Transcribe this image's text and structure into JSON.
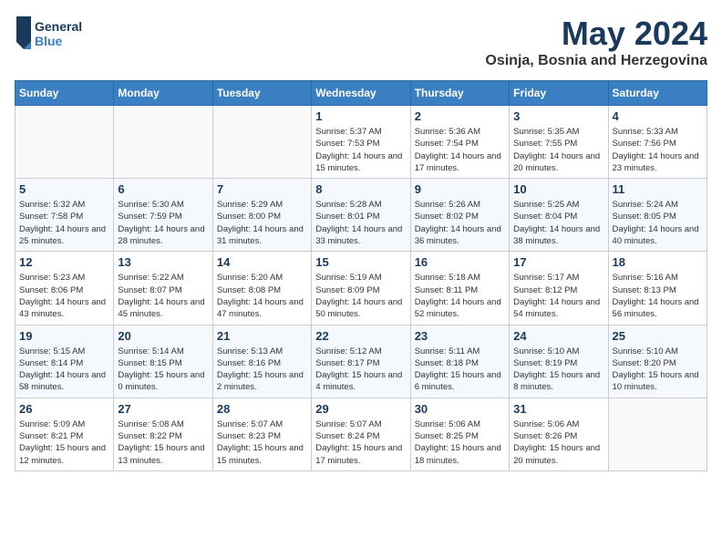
{
  "logo": {
    "line1": "General",
    "line2": "Blue"
  },
  "title": "May 2024",
  "location": "Osinja, Bosnia and Herzegovina",
  "days_of_week": [
    "Sunday",
    "Monday",
    "Tuesday",
    "Wednesday",
    "Thursday",
    "Friday",
    "Saturday"
  ],
  "weeks": [
    [
      {
        "day": "",
        "info": ""
      },
      {
        "day": "",
        "info": ""
      },
      {
        "day": "",
        "info": ""
      },
      {
        "day": "1",
        "info": "Sunrise: 5:37 AM\nSunset: 7:53 PM\nDaylight: 14 hours and 15 minutes."
      },
      {
        "day": "2",
        "info": "Sunrise: 5:36 AM\nSunset: 7:54 PM\nDaylight: 14 hours and 17 minutes."
      },
      {
        "day": "3",
        "info": "Sunrise: 5:35 AM\nSunset: 7:55 PM\nDaylight: 14 hours and 20 minutes."
      },
      {
        "day": "4",
        "info": "Sunrise: 5:33 AM\nSunset: 7:56 PM\nDaylight: 14 hours and 23 minutes."
      }
    ],
    [
      {
        "day": "5",
        "info": "Sunrise: 5:32 AM\nSunset: 7:58 PM\nDaylight: 14 hours and 25 minutes."
      },
      {
        "day": "6",
        "info": "Sunrise: 5:30 AM\nSunset: 7:59 PM\nDaylight: 14 hours and 28 minutes."
      },
      {
        "day": "7",
        "info": "Sunrise: 5:29 AM\nSunset: 8:00 PM\nDaylight: 14 hours and 31 minutes."
      },
      {
        "day": "8",
        "info": "Sunrise: 5:28 AM\nSunset: 8:01 PM\nDaylight: 14 hours and 33 minutes."
      },
      {
        "day": "9",
        "info": "Sunrise: 5:26 AM\nSunset: 8:02 PM\nDaylight: 14 hours and 36 minutes."
      },
      {
        "day": "10",
        "info": "Sunrise: 5:25 AM\nSunset: 8:04 PM\nDaylight: 14 hours and 38 minutes."
      },
      {
        "day": "11",
        "info": "Sunrise: 5:24 AM\nSunset: 8:05 PM\nDaylight: 14 hours and 40 minutes."
      }
    ],
    [
      {
        "day": "12",
        "info": "Sunrise: 5:23 AM\nSunset: 8:06 PM\nDaylight: 14 hours and 43 minutes."
      },
      {
        "day": "13",
        "info": "Sunrise: 5:22 AM\nSunset: 8:07 PM\nDaylight: 14 hours and 45 minutes."
      },
      {
        "day": "14",
        "info": "Sunrise: 5:20 AM\nSunset: 8:08 PM\nDaylight: 14 hours and 47 minutes."
      },
      {
        "day": "15",
        "info": "Sunrise: 5:19 AM\nSunset: 8:09 PM\nDaylight: 14 hours and 50 minutes."
      },
      {
        "day": "16",
        "info": "Sunrise: 5:18 AM\nSunset: 8:11 PM\nDaylight: 14 hours and 52 minutes."
      },
      {
        "day": "17",
        "info": "Sunrise: 5:17 AM\nSunset: 8:12 PM\nDaylight: 14 hours and 54 minutes."
      },
      {
        "day": "18",
        "info": "Sunrise: 5:16 AM\nSunset: 8:13 PM\nDaylight: 14 hours and 56 minutes."
      }
    ],
    [
      {
        "day": "19",
        "info": "Sunrise: 5:15 AM\nSunset: 8:14 PM\nDaylight: 14 hours and 58 minutes."
      },
      {
        "day": "20",
        "info": "Sunrise: 5:14 AM\nSunset: 8:15 PM\nDaylight: 15 hours and 0 minutes."
      },
      {
        "day": "21",
        "info": "Sunrise: 5:13 AM\nSunset: 8:16 PM\nDaylight: 15 hours and 2 minutes."
      },
      {
        "day": "22",
        "info": "Sunrise: 5:12 AM\nSunset: 8:17 PM\nDaylight: 15 hours and 4 minutes."
      },
      {
        "day": "23",
        "info": "Sunrise: 5:11 AM\nSunset: 8:18 PM\nDaylight: 15 hours and 6 minutes."
      },
      {
        "day": "24",
        "info": "Sunrise: 5:10 AM\nSunset: 8:19 PM\nDaylight: 15 hours and 8 minutes."
      },
      {
        "day": "25",
        "info": "Sunrise: 5:10 AM\nSunset: 8:20 PM\nDaylight: 15 hours and 10 minutes."
      }
    ],
    [
      {
        "day": "26",
        "info": "Sunrise: 5:09 AM\nSunset: 8:21 PM\nDaylight: 15 hours and 12 minutes."
      },
      {
        "day": "27",
        "info": "Sunrise: 5:08 AM\nSunset: 8:22 PM\nDaylight: 15 hours and 13 minutes."
      },
      {
        "day": "28",
        "info": "Sunrise: 5:07 AM\nSunset: 8:23 PM\nDaylight: 15 hours and 15 minutes."
      },
      {
        "day": "29",
        "info": "Sunrise: 5:07 AM\nSunset: 8:24 PM\nDaylight: 15 hours and 17 minutes."
      },
      {
        "day": "30",
        "info": "Sunrise: 5:06 AM\nSunset: 8:25 PM\nDaylight: 15 hours and 18 minutes."
      },
      {
        "day": "31",
        "info": "Sunrise: 5:06 AM\nSunset: 8:26 PM\nDaylight: 15 hours and 20 minutes."
      },
      {
        "day": "",
        "info": ""
      }
    ]
  ]
}
